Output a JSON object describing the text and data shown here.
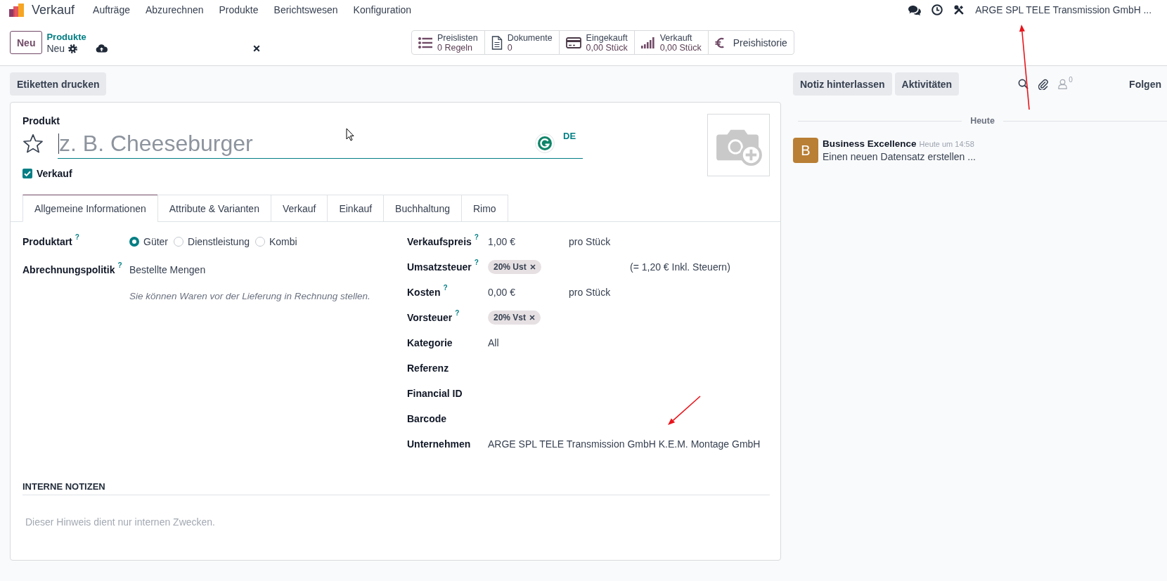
{
  "navbar": {
    "app_name": "Verkauf",
    "menu": [
      "Aufträge",
      "Abzurechnen",
      "Produkte",
      "Berichtswesen",
      "Konfiguration"
    ],
    "company": "ARGE SPL TELE Transmission GmbH ..."
  },
  "control_panel": {
    "new_button": "Neu",
    "breadcrumb": {
      "parent": "Produkte",
      "current": "Neu"
    },
    "smart_buttons": [
      {
        "kind": "list",
        "label": "Preislisten",
        "value": "0 Regeln"
      },
      {
        "kind": "document",
        "label": "Dokumente",
        "value": "0"
      },
      {
        "kind": "card",
        "label": "Eingekauft",
        "value": "0,00 Stück"
      },
      {
        "kind": "signal",
        "label": "Verkauft",
        "value": "0,00 Stück"
      },
      {
        "kind": "euro",
        "label": "Preishistorie"
      }
    ]
  },
  "action_buttons": [
    "Etiketten drucken"
  ],
  "form": {
    "name_label": "Produkt",
    "name_placeholder": "z. B. Cheeseburger",
    "favorite": false,
    "language": "DE",
    "options": [
      {
        "label": "Verkauf",
        "checked": true
      }
    ],
    "tabs": [
      {
        "label": "Allgemeine Informationen",
        "selected": true
      },
      {
        "label": "Attribute & Varianten",
        "selected": false
      },
      {
        "label": "Verkauf",
        "selected": false
      },
      {
        "label": "Einkauf",
        "selected": false
      },
      {
        "label": "Buchhaltung",
        "selected": false
      },
      {
        "label": "Rimo",
        "selected": false
      }
    ],
    "left_fields": [
      {
        "kind": "radio",
        "label": "Produktart",
        "help": "?",
        "options": [
          {
            "label": "Güter",
            "selected": true
          },
          {
            "label": "Dienstleistung",
            "selected": false
          },
          {
            "label": "Kombi",
            "selected": false
          }
        ]
      },
      {
        "kind": "text",
        "label": "Abrechnungspolitik",
        "help": "?",
        "value": "Bestellte Mengen",
        "hint": "Sie können Waren vor der Lieferung in Rechnung stellen."
      }
    ],
    "right_fields": [
      {
        "kind": "money",
        "label": "Verkaufspreis",
        "help": "?",
        "value": "1,00 €",
        "unit": "pro Stück"
      },
      {
        "kind": "tags",
        "label": "Umsatzsteuer",
        "help": "?",
        "tags": [
          "20% Ust"
        ],
        "note": "(= 1,20 € Inkl. Steuern)"
      },
      {
        "kind": "money",
        "label": "Kosten",
        "help": "?",
        "value": "0,00 €",
        "unit": "pro Stück"
      },
      {
        "kind": "tags",
        "label": "Vorsteuer",
        "help": "?",
        "tags": [
          "20% Vst"
        ]
      },
      {
        "kind": "text",
        "label": "Kategorie",
        "value": "All"
      },
      {
        "kind": "text",
        "label": "Referenz"
      },
      {
        "kind": "text",
        "label": "Financial ID"
      },
      {
        "kind": "text",
        "label": "Barcode"
      },
      {
        "kind": "text",
        "label": "Unternehmen",
        "value": "ARGE SPL TELE Transmission GmbH K.E.M. Montage GmbH"
      }
    ],
    "notes": {
      "title": "INTERNE NOTIZEN",
      "placeholder": "Dieser Hinweis dient nur internen Zwecken."
    }
  },
  "chatter": {
    "buttons": [
      "Notiz hinterlassen",
      "Aktivitäten"
    ],
    "followers_count": "0",
    "follow": "Folgen",
    "separator": "Heute",
    "messages": [
      {
        "avatar": "B",
        "author": "Business Excellence",
        "time": "Heute um 14:58",
        "text": "Einen neuen Datensatz erstellen ..."
      }
    ]
  }
}
